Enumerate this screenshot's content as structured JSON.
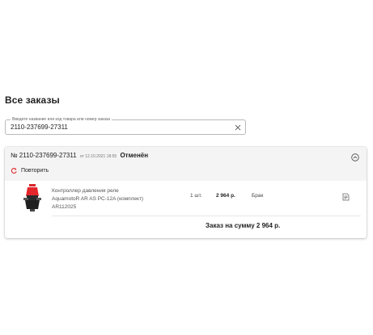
{
  "page": {
    "title": "Все заказы"
  },
  "search": {
    "label": "Введите название или код товара или номер заказа",
    "value": "2110-237699-27311",
    "clear_icon": "close-icon"
  },
  "order": {
    "number": "№ 2110-237699-27311",
    "date": "от 12.10.2021 18:55",
    "status": "Отменён",
    "repeat_label": "Повторить",
    "items": [
      {
        "name_line1": "Контроллер давления реле",
        "name_line2": "AquamotoR AR AS PC-12A (комплект)",
        "code": "AR112025",
        "qty": "1 шт.",
        "price": "2 964 р.",
        "status": "Брак"
      }
    ],
    "total": "Заказ на сумму 2 964 р."
  },
  "colors": {
    "accent": "#e3262b",
    "header_bg": "#f4f4f4",
    "border": "#b9b9b9"
  }
}
